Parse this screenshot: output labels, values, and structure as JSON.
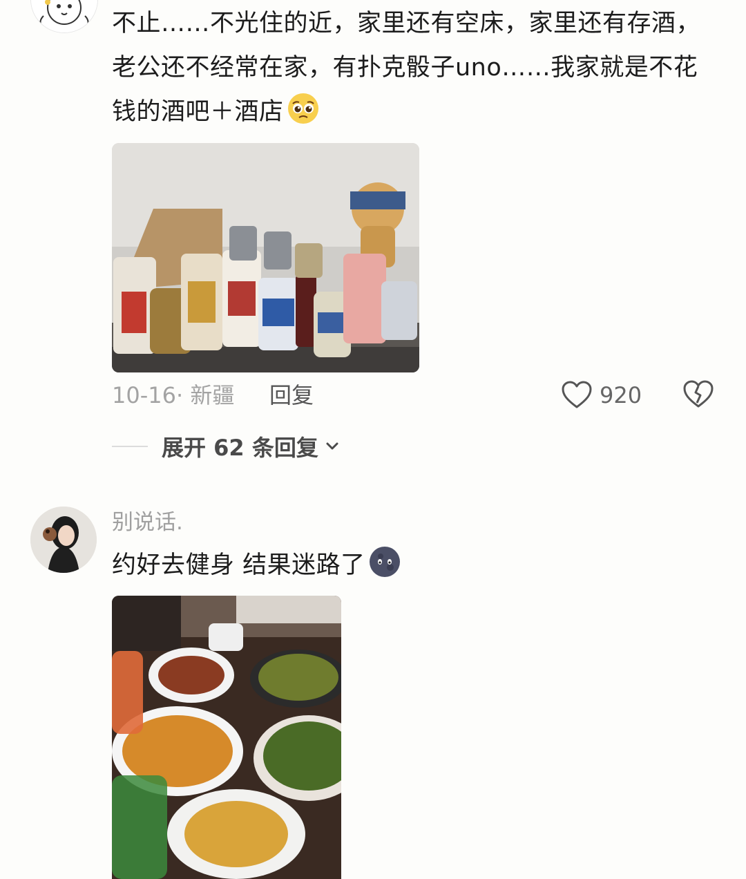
{
  "comments": [
    {
      "avatar": "cartoon-avatar",
      "text": "不止……不光住的近，家里还有空床，家里还有存酒，老公还不经常在家，有扑克骰子uno……我家就是不花钱的酒吧＋酒店",
      "emoji": "pleading-face-emoji",
      "photo": "drink-cans-photo",
      "date_location": "10-16· 新疆",
      "reply_label": "回复",
      "like_count": "920",
      "expand_label": "展开 62 条回复"
    },
    {
      "avatar": "girl-avatar",
      "username": "别说话.",
      "text": "约好去健身 结果迷路了",
      "emoji": "new-moon-face-emoji",
      "photo": "dinner-table-photo"
    }
  ],
  "colors": {
    "background": "#fdfdfb",
    "text": "#1c1c1c",
    "meta": "#a3a3a3"
  }
}
